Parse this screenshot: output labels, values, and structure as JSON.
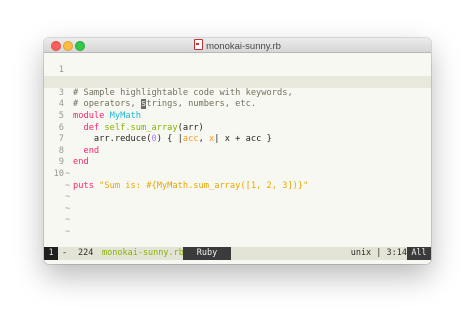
{
  "window": {
    "title": "monokai-sunny.rb",
    "file_icon": "ruby-file-icon"
  },
  "editor": {
    "lines": [
      {
        "num": "1"
      },
      {
        "num": "2",
        "comment": "# Sample highlightable code with keywords,"
      },
      {
        "num": "3",
        "before_cursor": "# operators, ",
        "cursor_char": "s",
        "after_cursor": "trings, numbers, etc."
      },
      {
        "num": "4",
        "kw": "module",
        "cls": "MyMath"
      },
      {
        "num": "5",
        "kw": "def",
        "fn": "self.sum_array",
        "args": "(arr)"
      },
      {
        "num": "6",
        "pre": "arr.reduce(",
        "num_lit": "0",
        "mid1": ") { |",
        "v1": "acc",
        "mid2": ", ",
        "v2": "x",
        "mid3": "| x + acc }"
      },
      {
        "num": "7",
        "kw": "end"
      },
      {
        "num": "8",
        "kw": "end"
      },
      {
        "num": "9"
      },
      {
        "num": "10",
        "call": "puts",
        "str": "\"Sum is: #{MyMath.sum_array([1, 2, 3])}\""
      }
    ],
    "tilde": "~"
  },
  "statusbar": {
    "window_num": "1",
    "modified": "-",
    "line_count": "224",
    "buffer_name": "monokai-sunny.rb",
    "mode": "Ruby",
    "right_info": "unix | 3:14",
    "position": "All"
  }
}
